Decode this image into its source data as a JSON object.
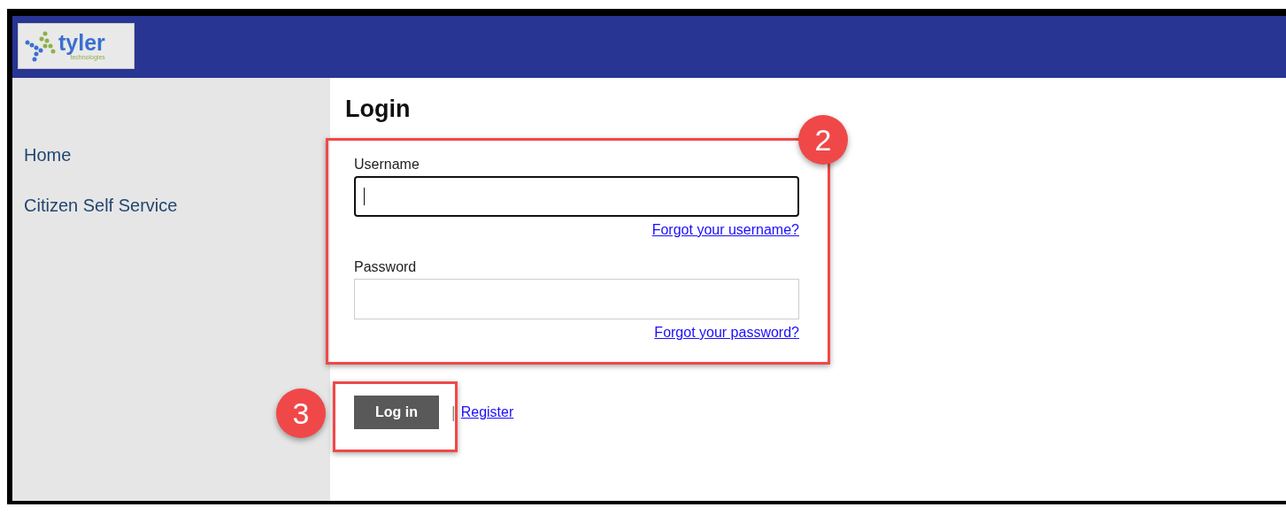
{
  "header": {
    "logo": {
      "name": "tyler",
      "tagline": "technologies"
    }
  },
  "sidebar": {
    "items": [
      {
        "label": "Home"
      },
      {
        "label": "Citizen Self Service"
      }
    ]
  },
  "login": {
    "title": "Login",
    "fields": [
      {
        "label": "Username",
        "focused": true,
        "link": "Forgot your username?"
      },
      {
        "label": "Password",
        "focused": false,
        "link": "Forgot your password?"
      }
    ],
    "submit": "Log in",
    "separator": "|",
    "register": "Register"
  },
  "callouts": [
    {
      "number": "2"
    },
    {
      "number": "3"
    }
  ]
}
